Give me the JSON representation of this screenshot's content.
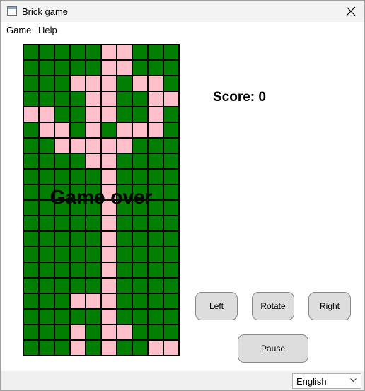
{
  "window": {
    "title": "Brick game",
    "icon": "app-window-icon",
    "close_icon": "close-icon"
  },
  "menu": {
    "items": [
      {
        "label": "Game"
      },
      {
        "label": "Help"
      }
    ]
  },
  "board": {
    "cols": 10,
    "rows_count": 20,
    "colors": {
      "G": "#007f00",
      "P": "#ffc0cb"
    },
    "rows": [
      "GGGGGPPGGG",
      "GGGGGPPGGG",
      "GGGPPPGPPG",
      "GGGGPPGGPP",
      "PPGGPPGGPG",
      "GPPGPGPPPG",
      "GGPPPPPGGG",
      "GGGGPPGGGG",
      "GGGGGPGGGG",
      "GGGGGPGGGG",
      "GGGGGPGGGG",
      "GGGGGPGGGG",
      "GGGGGPGGGG",
      "GGGGGPGGGG",
      "GGGGGPGGGG",
      "GGGGGPGGGG",
      "GGGPPPGGGG",
      "GGGGGPGGGG",
      "GGGPGPPGGG",
      "GGGPGPGGPP"
    ]
  },
  "overlay": {
    "game_over": "Game over"
  },
  "score": {
    "label": "Score: ",
    "value": "0"
  },
  "buttons": {
    "left": "Left",
    "rotate": "Rotate",
    "right": "Right",
    "pause": "Pause"
  },
  "language": {
    "selected": "English"
  }
}
